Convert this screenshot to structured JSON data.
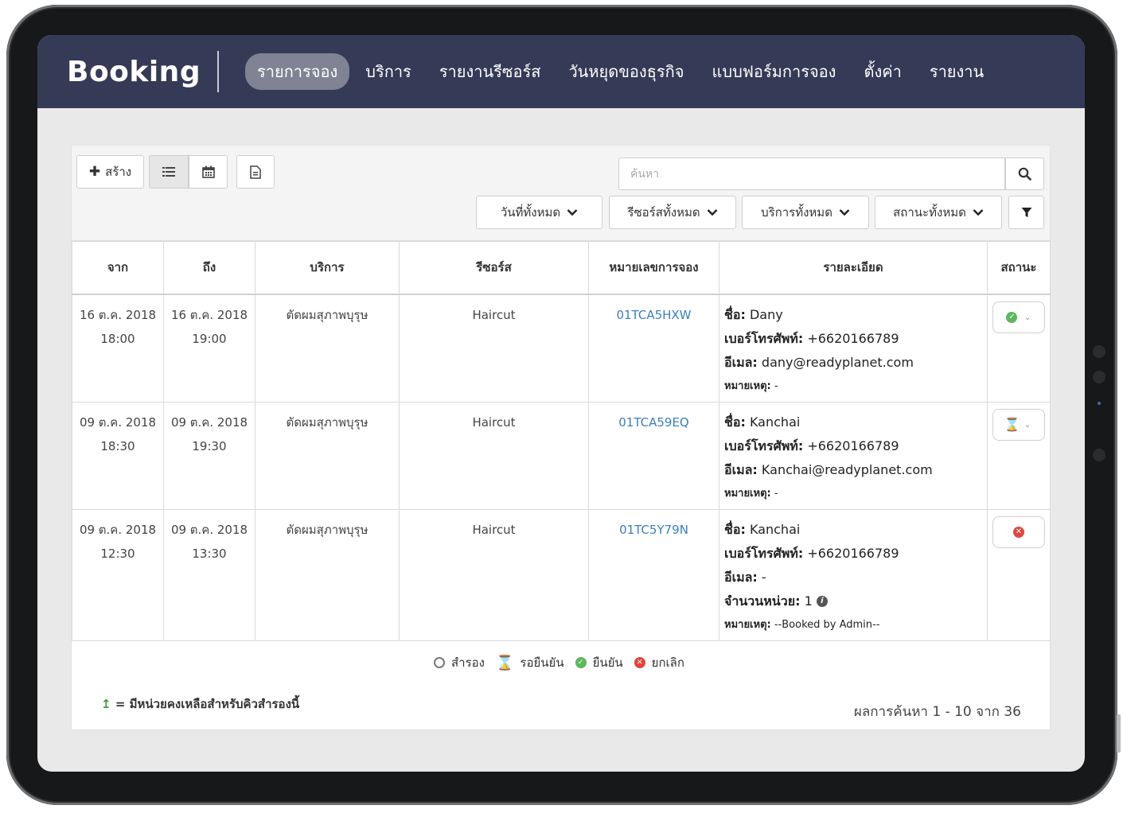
{
  "app": {
    "brand": "Booking"
  },
  "nav": [
    {
      "label": "รายการจอง",
      "active": true
    },
    {
      "label": "บริการ"
    },
    {
      "label": "รายงานรีซอร์ส"
    },
    {
      "label": "วันหยุดของธุรกิจ"
    },
    {
      "label": "แบบฟอร์มการจอง"
    },
    {
      "label": "ตั้งค่า"
    },
    {
      "label": "รายงาน"
    }
  ],
  "toolbar": {
    "create_label": "สร้าง",
    "search_placeholder": "ค้นหา",
    "filters": {
      "dates": "วันที่ทั้งหมด",
      "resources": "รีซอร์สทั้งหมด",
      "services": "บริการทั้งหมด",
      "statuses": "สถานะทั้งหมด"
    }
  },
  "table": {
    "headers": [
      "จาก",
      "ถึง",
      "บริการ",
      "รีซอร์ส",
      "หมายเลขการจอง",
      "รายละเอียด",
      "สถานะ"
    ],
    "rows": [
      {
        "from_date": "16 ต.ค. 2018",
        "from_time": "18:00",
        "to_date": "16 ต.ค. 2018",
        "to_time": "19:00",
        "service": "ตัดผมสุภาพบุรุษ",
        "resource": "Haircut",
        "ref": "01TCA5HXW",
        "name_label": "ชื่อ:",
        "name": "Dany",
        "phone_label": "เบอร์โทรศัพท์:",
        "phone": "+6620166789",
        "email_label": "อีเมล:",
        "email": "dany@readyplanet.com",
        "note_label": "หมายเหตุ:",
        "note": "-",
        "status": "confirmed"
      },
      {
        "from_date": "09 ต.ค. 2018",
        "from_time": "18:30",
        "to_date": "09 ต.ค. 2018",
        "to_time": "19:30",
        "service": "ตัดผมสุภาพบุรุษ",
        "resource": "Haircut",
        "ref": "01TCA59EQ",
        "name_label": "ชื่อ:",
        "name": "Kanchai",
        "phone_label": "เบอร์โทรศัพท์:",
        "phone": "+6620166789",
        "email_label": "อีเมล:",
        "email": "Kanchai@readyplanet.com",
        "note_label": "หมายเหตุ:",
        "note": "-",
        "status": "waiting"
      },
      {
        "from_date": "09 ต.ค. 2018",
        "from_time": "12:30",
        "to_date": "09 ต.ค. 2018",
        "to_time": "13:30",
        "service": "ตัดผมสุภาพบุรุษ",
        "resource": "Haircut",
        "ref": "01TC5Y79N",
        "name_label": "ชื่อ:",
        "name": "Kanchai",
        "phone_label": "เบอร์โทรศัพท์:",
        "phone": "+6620166789",
        "email_label": "อีเมล:",
        "email": "-",
        "units_label": "จำนวนหน่วย:",
        "units": "1",
        "note_label": "หมายเหตุ:",
        "note": "--Booked by Admin--",
        "status": "cancelled"
      }
    ]
  },
  "legend": {
    "pending": "สำรอง",
    "waiting": "รอยืนยัน",
    "confirmed": "ยืนยัน",
    "cancelled": "ยกเลิก"
  },
  "footer": {
    "note_arrow": "↥",
    "note_text": "= มีหน่วยคงเหลือสำหรับคิวสำรองนี้",
    "results": "ผลการค้นหา 1 - 10 จาก 36"
  },
  "colors": {
    "nav_bg": "#353a56",
    "nav_active": "#7f8393",
    "link": "#3a7fc1",
    "confirmed": "#5cb85c",
    "waiting": "#e7b724",
    "cancelled": "#e0463c"
  }
}
